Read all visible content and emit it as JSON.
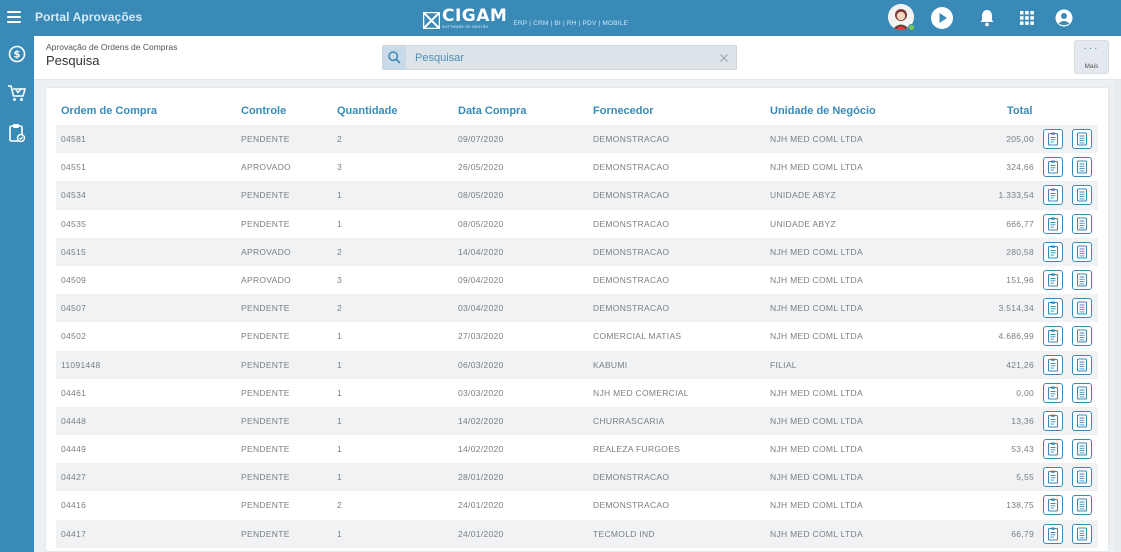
{
  "app": {
    "title": "Portal Aprovações"
  },
  "logo": {
    "word": "CIGAM",
    "sub": "SOFTWARE DE GESTÃO",
    "modules": "ERP | CRM | BI | RH | PDV | MOBILE"
  },
  "header": {
    "breadcrumb": "Aprovação de Ordens de Compras",
    "title": "Pesquisa",
    "search_placeholder": "Pesquisar",
    "more_label": "Mais",
    "more_dots": "···"
  },
  "table": {
    "columns": [
      "Ordem de Compra",
      "Controle",
      "Quantidade",
      "Data Compra",
      "Fornecedor",
      "Unidade de Negócio",
      "Total"
    ],
    "rows": [
      [
        "04581",
        "PENDENTE",
        "2",
        "09/07/2020",
        "DEMONSTRACAO",
        "NJH MED COML LTDA",
        "205,00"
      ],
      [
        "04551",
        "APROVADO",
        "3",
        "26/05/2020",
        "DEMONSTRACAO",
        "NJH MED COML LTDA",
        "324,66"
      ],
      [
        "04534",
        "PENDENTE",
        "1",
        "08/05/2020",
        "DEMONSTRACAO",
        "UNIDADE ABYZ",
        "1.333,54"
      ],
      [
        "04535",
        "PENDENTE",
        "1",
        "08/05/2020",
        "DEMONSTRACAO",
        "UNIDADE ABYZ",
        "666,77"
      ],
      [
        "04515",
        "APROVADO",
        "2",
        "14/04/2020",
        "DEMONSTRACAO",
        "NJH MED COML LTDA",
        "280,58"
      ],
      [
        "04509",
        "APROVADO",
        "3",
        "09/04/2020",
        "DEMONSTRACAO",
        "NJH MED COML LTDA",
        "151,96"
      ],
      [
        "04507",
        "PENDENTE",
        "2",
        "03/04/2020",
        "DEMONSTRACAO",
        "NJH MED COML LTDA",
        "3.514,34"
      ],
      [
        "04502",
        "PENDENTE",
        "1",
        "27/03/2020",
        "COMERCIAL MATIAS",
        "NJH MED COML LTDA",
        "4.686,99"
      ],
      [
        "11091448",
        "PENDENTE",
        "1",
        "06/03/2020",
        "KABUMI",
        "FILIAL",
        "421,26"
      ],
      [
        "04461",
        "PENDENTE",
        "1",
        "03/03/2020",
        "NJH MED COMERCIAL",
        "NJH MED COML LTDA",
        "0,00"
      ],
      [
        "04448",
        "PENDENTE",
        "1",
        "14/02/2020",
        "CHURRASCARIA",
        "NJH MED COML LTDA",
        "13,36"
      ],
      [
        "04449",
        "PENDENTE",
        "1",
        "14/02/2020",
        "REALEZA FURGOES",
        "NJH MED COML LTDA",
        "53,43"
      ],
      [
        "04427",
        "PENDENTE",
        "1",
        "28/01/2020",
        "DEMONSTRACAO",
        "NJH MED COML LTDA",
        "5,55"
      ],
      [
        "04416",
        "PENDENTE",
        "2",
        "24/01/2020",
        "DEMONSTRACAO",
        "NJH MED COML LTDA",
        "138,75"
      ],
      [
        "04417",
        "PENDENTE",
        "1",
        "24/01/2020",
        "TECMOLD IND",
        "NJH MED COML LTDA",
        "66,79"
      ]
    ]
  },
  "icons": {
    "menu": "hamburger-menu-icon",
    "avatar": "user-avatar-icon",
    "play": "play-icon",
    "notifications": "bell-icon",
    "apps": "apps-grid-icon",
    "profile": "account-circle-icon",
    "sidebar": [
      "dollar-circle-icon",
      "shopping-cart-icon",
      "clipboard-approval-icon"
    ],
    "row_actions": [
      "document-details-icon",
      "document-list-icon"
    ]
  },
  "colors": {
    "primary": "#3a8ab8",
    "row_alt": "#f0f2f4",
    "status_online": "#7ac943"
  }
}
